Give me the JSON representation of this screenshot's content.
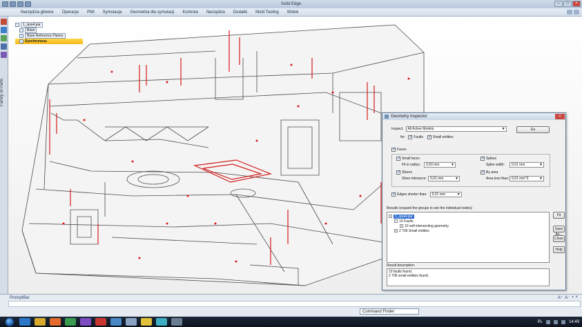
{
  "app_title": "Solid Edge",
  "ribbon_tabs": [
    "Narzędzia główne",
    "Operacje",
    "PMI",
    "Symulacja",
    "Geometria dla symulacji",
    "Kontrola",
    "Narzędzia",
    "Dodatki",
    "Mold Tooling",
    "Widok"
  ],
  "left_bar": {
    "family_label": "Family of Parts"
  },
  "pathfinder": {
    "items": [
      "1_spw4.par",
      "Base",
      "Base Reference Planes",
      "Synchronous"
    ]
  },
  "dialog": {
    "title": "Geometry Inspector",
    "inspect_label": "Inspect:",
    "inspect_value": "All Active Models",
    "go_label": "Go",
    "for_label": "for:",
    "faults_label": "Faults",
    "small_entities_label": "Small entities",
    "faces_label": "Faces",
    "small_faces_label": "Small faces",
    "fit_in_radius_label": "Fit in radius:",
    "fit_in_radius_value": "0,50 mm",
    "spikes_label": "Spikes",
    "spike_width_label": "Spike width:",
    "spike_width_value": "0,01 mm",
    "slivers_label": "Slivers",
    "sliver_tolerance_label": "Sliver tolerance:",
    "sliver_tolerance_value": "0,01 mm",
    "by_area_label": "By area",
    "area_less_than_label": "Area less than:",
    "area_less_than_value": "0,01 mm^2",
    "edges_shorter_label": "Edges shorter than:",
    "edges_shorter_value": "0,01 mm",
    "results_label": "Results (expand the groups to see the individual nodes):",
    "results": {
      "root": "1_spw4.par",
      "faults": "10 Faults",
      "fault_child": "10 self intersecting geometry",
      "small_entities": "2 706 Small entities"
    },
    "result_description_label": "Result description:",
    "result_description_lines": [
      "10 faults found.",
      "2 706 small entities found."
    ],
    "buttons": {
      "fit": "Fit",
      "save_as": "Save As...",
      "close": "Close",
      "help": "Help"
    }
  },
  "promptbar": {
    "label": "PromptBar",
    "command_finder": "Command Finder"
  },
  "taskbar": {
    "lang": "PL",
    "time": "14:49"
  }
}
